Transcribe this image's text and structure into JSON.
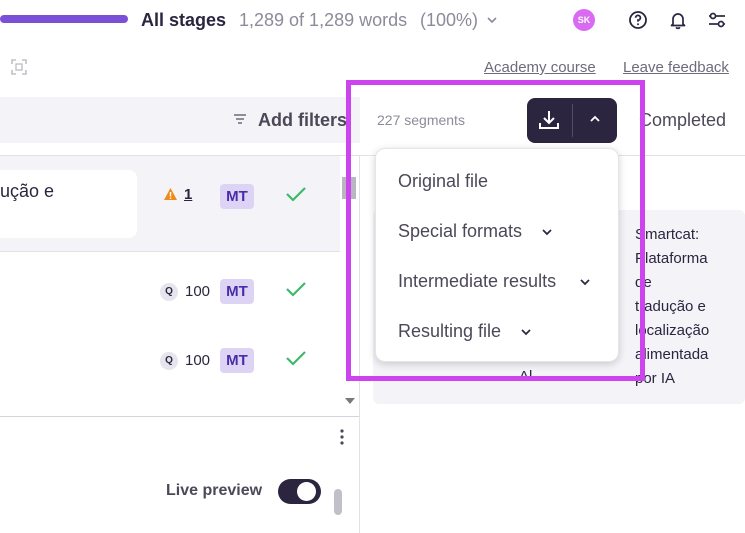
{
  "header": {
    "stage_title": "All stages",
    "words_count": "1,289 of 1,289 words",
    "words_pct": "(100%)",
    "avatar_initials": "SK",
    "progress_color": "#7b4fd6"
  },
  "links": {
    "academy": "Academy course",
    "feedback": "Leave feedback"
  },
  "toolbar": {
    "filters_label": "Add filters",
    "segments_label": "227 segments",
    "completed_label": "Completed"
  },
  "segments": [
    {
      "text": "ução e",
      "warning_count": "1",
      "badge": "MT"
    },
    {
      "q_label": "Q",
      "score": "100",
      "badge": "MT"
    },
    {
      "q_label": "Q",
      "score": "100",
      "badge": "MT"
    }
  ],
  "footer": {
    "live_preview_label": "Live preview",
    "live_preview_on": true
  },
  "preview": {
    "lines": [
      "Smartcat:",
      "Plataforma",
      "de",
      "tradução e",
      "localização",
      "alimentada",
      "por IA"
    ],
    "left_fragment": "Al"
  },
  "download_menu": {
    "items": [
      "Original file",
      "Special formats",
      "Intermediate results",
      "Resulting file"
    ]
  },
  "colors": {
    "accent_dark": "#2b2540",
    "highlight": "#cc44ee",
    "avatar": "#d96af2"
  }
}
